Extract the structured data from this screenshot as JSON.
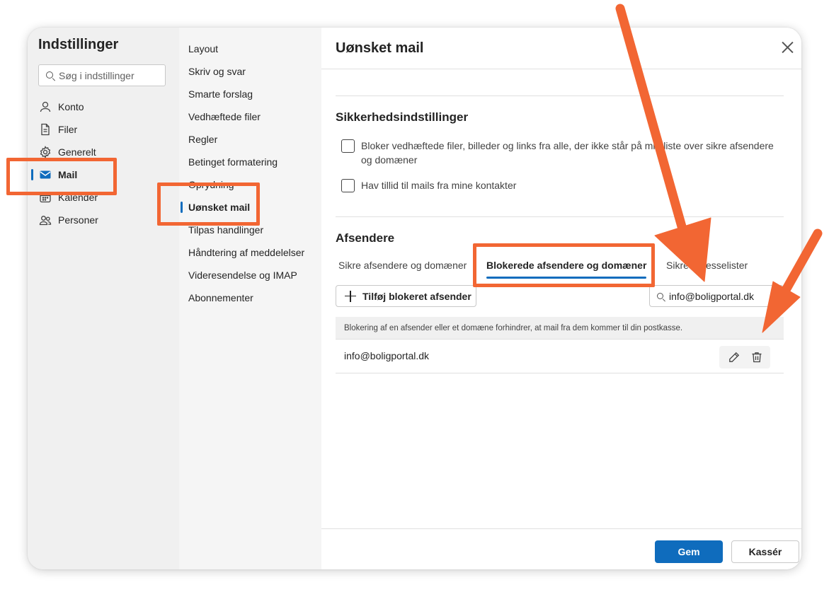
{
  "settings": {
    "title": "Indstillinger",
    "search_placeholder": "Søg i indstillinger",
    "nav": [
      {
        "label": "Konto",
        "icon": "person-icon"
      },
      {
        "label": "Filer",
        "icon": "file-icon"
      },
      {
        "label": "Generelt",
        "icon": "gear-icon"
      },
      {
        "label": "Mail",
        "icon": "mail-icon",
        "active": true
      },
      {
        "label": "Kalender",
        "icon": "calendar-icon"
      },
      {
        "label": "Personer",
        "icon": "people-icon"
      }
    ]
  },
  "mail_nav": {
    "items": [
      {
        "label": "Layout"
      },
      {
        "label": "Skriv og svar"
      },
      {
        "label": "Smarte forslag"
      },
      {
        "label": "Vedhæftede filer"
      },
      {
        "label": "Regler"
      },
      {
        "label": "Betinget formatering"
      },
      {
        "label": "Oprydning"
      },
      {
        "label": "Uønsket mail",
        "active": true
      },
      {
        "label": "Tilpas handlinger"
      },
      {
        "label": "Håndtering af meddelelser"
      },
      {
        "label": "Videresendelse og IMAP"
      },
      {
        "label": "Abonnementer"
      }
    ]
  },
  "pane": {
    "title": "Uønsket mail",
    "security": {
      "title": "Sikkerhedsindstillinger",
      "options": [
        {
          "label": "Bloker vedhæftede filer, billeder og links fra alle, der ikke står på min liste over sikre afsendere og domæner",
          "checked": false
        },
        {
          "label": "Hav tillid til mails fra mine kontakter",
          "checked": false
        }
      ]
    },
    "senders": {
      "title": "Afsendere",
      "tabs": [
        {
          "label": "Sikre afsendere og domæner"
        },
        {
          "label": "Blokerede afsendere og domæner",
          "active": true
        },
        {
          "label": "Sikre adresselister"
        }
      ],
      "add_button": "Tilføj blokeret afsender",
      "filter_value": "info@boligportal.dk",
      "info_text": "Blokering af en afsender eller et domæne forhindrer, at mail fra dem kommer til din postkasse.",
      "rows": [
        {
          "address": "info@boligportal.dk"
        }
      ]
    },
    "save": "Gem",
    "discard": "Kassér"
  },
  "colors": {
    "accent": "#0f6cbd",
    "annotation": "#f26633"
  }
}
